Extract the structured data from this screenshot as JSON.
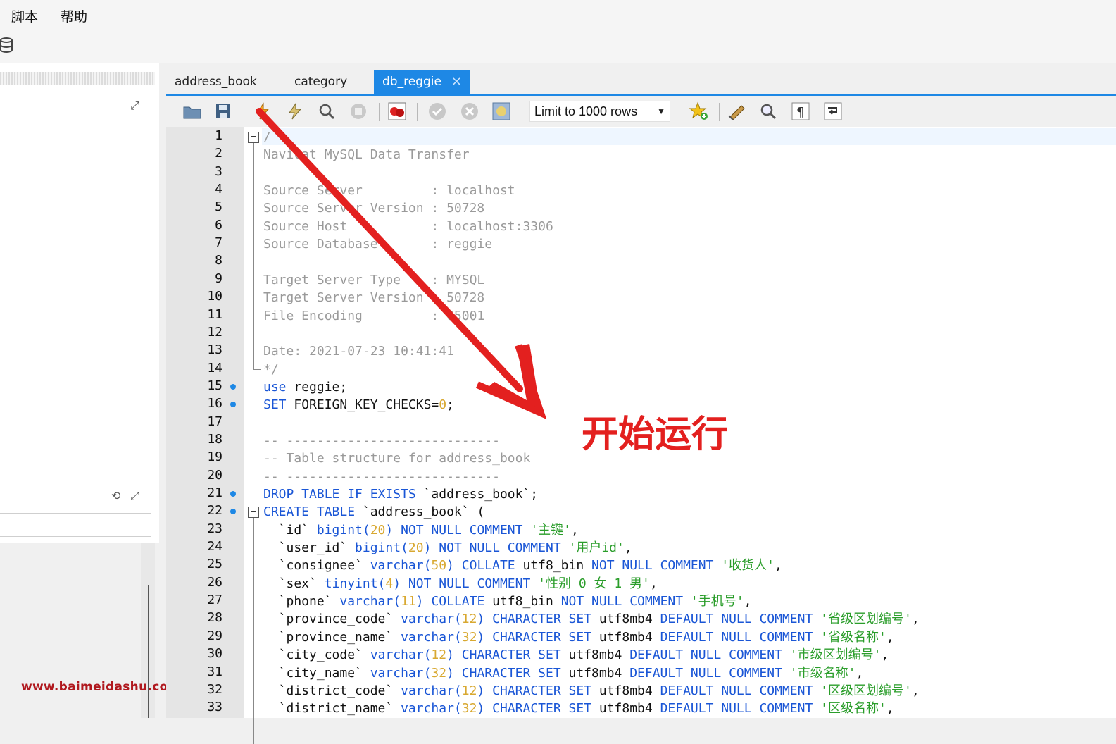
{
  "menu": {
    "items": [
      {
        "label": "脚本"
      },
      {
        "label": "帮助"
      }
    ]
  },
  "tabs": [
    {
      "label": "address_book"
    },
    {
      "label": "category"
    },
    {
      "label": "db_reggie",
      "close": "×"
    }
  ],
  "toolbar": {
    "limit_select": "Limit to 1000 rows"
  },
  "annotation": "开始运行",
  "watermark": "www.baimeidashu.com-白眉大叔",
  "colors": {
    "accent": "#1e88e5",
    "annotation": "#e3201f",
    "keyword": "#1a56d6",
    "string": "#2a9d2a",
    "number": "#d8a830",
    "comment": "#9a9a9a"
  },
  "icons": [
    "folder-icon",
    "save-icon",
    "run-icon",
    "run-selected-icon",
    "explain-icon",
    "stop-icon",
    "beautify-icon",
    "commit-icon",
    "rollback-icon",
    "transaction-icon",
    "add-favorite-icon",
    "clear-icon",
    "find-icon",
    "paragraph-icon",
    "wrap-icon",
    "arrow-annotation-icon"
  ],
  "editor": {
    "lines": [
      {
        "n": "1",
        "segs": [
          {
            "c": "cm",
            "t": "/"
          }
        ]
      },
      {
        "n": "2",
        "segs": [
          {
            "c": "cm",
            "t": "Navicat MySQL Data Transfer"
          }
        ]
      },
      {
        "n": "3",
        "segs": []
      },
      {
        "n": "4",
        "segs": [
          {
            "c": "cm",
            "t": "Source Server         : localhost"
          }
        ]
      },
      {
        "n": "5",
        "segs": [
          {
            "c": "cm",
            "t": "Source Server Version : 50728"
          }
        ]
      },
      {
        "n": "6",
        "segs": [
          {
            "c": "cm",
            "t": "Source Host           : localhost:3306"
          }
        ]
      },
      {
        "n": "7",
        "segs": [
          {
            "c": "cm",
            "t": "Source Database       : reggie"
          }
        ]
      },
      {
        "n": "8",
        "segs": []
      },
      {
        "n": "9",
        "segs": [
          {
            "c": "cm",
            "t": "Target Server Type    : MYSQL"
          }
        ]
      },
      {
        "n": "10",
        "segs": [
          {
            "c": "cm",
            "t": "Target Server Version : 50728"
          }
        ]
      },
      {
        "n": "11",
        "segs": [
          {
            "c": "cm",
            "t": "File Encoding         : 65001"
          }
        ]
      },
      {
        "n": "12",
        "segs": []
      },
      {
        "n": "13",
        "segs": [
          {
            "c": "cm",
            "t": "Date: 2021-07-23 10:41:41"
          }
        ]
      },
      {
        "n": "14",
        "segs": [
          {
            "c": "cm",
            "t": "*/"
          }
        ]
      },
      {
        "n": "15",
        "bm": true,
        "segs": [
          {
            "c": "kw",
            "t": "use"
          },
          {
            "c": "id",
            "t": " reggie;"
          }
        ]
      },
      {
        "n": "16",
        "bm": true,
        "segs": [
          {
            "c": "kw",
            "t": "SET"
          },
          {
            "c": "id",
            "t": " FOREIGN_KEY_CHECKS="
          },
          {
            "c": "num",
            "t": "0"
          },
          {
            "c": "id",
            "t": ";"
          }
        ]
      },
      {
        "n": "17",
        "segs": []
      },
      {
        "n": "18",
        "segs": [
          {
            "c": "cm",
            "t": "-- ----------------------------"
          }
        ]
      },
      {
        "n": "19",
        "segs": [
          {
            "c": "cm",
            "t": "-- Table structure for address_book"
          }
        ]
      },
      {
        "n": "20",
        "segs": [
          {
            "c": "cm",
            "t": "-- ----------------------------"
          }
        ]
      },
      {
        "n": "21",
        "bm": true,
        "segs": [
          {
            "c": "kw",
            "t": "DROP TABLE IF EXISTS"
          },
          {
            "c": "id",
            "t": " `address_book`;"
          }
        ]
      },
      {
        "n": "22",
        "bm": true,
        "segs": [
          {
            "c": "kw",
            "t": "CREATE TABLE"
          },
          {
            "c": "id",
            "t": " `address_book` ("
          }
        ]
      },
      {
        "n": "23",
        "segs": [
          {
            "c": "id",
            "t": "  `id` "
          },
          {
            "c": "kw",
            "t": "bigint("
          },
          {
            "c": "num",
            "t": "20"
          },
          {
            "c": "kw",
            "t": ") NOT NULL COMMENT "
          },
          {
            "c": "str",
            "t": "'主键'"
          },
          {
            "c": "id",
            "t": ","
          }
        ]
      },
      {
        "n": "24",
        "segs": [
          {
            "c": "id",
            "t": "  `user_id` "
          },
          {
            "c": "kw",
            "t": "bigint("
          },
          {
            "c": "num",
            "t": "20"
          },
          {
            "c": "kw",
            "t": ") NOT NULL COMMENT "
          },
          {
            "c": "str",
            "t": "'用户id'"
          },
          {
            "c": "id",
            "t": ","
          }
        ]
      },
      {
        "n": "25",
        "segs": [
          {
            "c": "id",
            "t": "  `consignee` "
          },
          {
            "c": "kw",
            "t": "varchar("
          },
          {
            "c": "num",
            "t": "50"
          },
          {
            "c": "kw",
            "t": ") COLLATE "
          },
          {
            "c": "id",
            "t": "utf8_bin "
          },
          {
            "c": "kw",
            "t": "NOT NULL COMMENT "
          },
          {
            "c": "str",
            "t": "'收货人'"
          },
          {
            "c": "id",
            "t": ","
          }
        ]
      },
      {
        "n": "26",
        "segs": [
          {
            "c": "id",
            "t": "  `sex` "
          },
          {
            "c": "kw",
            "t": "tinyint("
          },
          {
            "c": "num",
            "t": "4"
          },
          {
            "c": "kw",
            "t": ") NOT NULL COMMENT "
          },
          {
            "c": "str",
            "t": "'性别 0 女 1 男'"
          },
          {
            "c": "id",
            "t": ","
          }
        ]
      },
      {
        "n": "27",
        "segs": [
          {
            "c": "id",
            "t": "  `phone` "
          },
          {
            "c": "kw",
            "t": "varchar("
          },
          {
            "c": "num",
            "t": "11"
          },
          {
            "c": "kw",
            "t": ") COLLATE "
          },
          {
            "c": "id",
            "t": "utf8_bin "
          },
          {
            "c": "kw",
            "t": "NOT NULL COMMENT "
          },
          {
            "c": "str",
            "t": "'手机号'"
          },
          {
            "c": "id",
            "t": ","
          }
        ]
      },
      {
        "n": "28",
        "segs": [
          {
            "c": "id",
            "t": "  `province_code` "
          },
          {
            "c": "kw",
            "t": "varchar("
          },
          {
            "c": "num",
            "t": "12"
          },
          {
            "c": "kw",
            "t": ") CHARACTER SET "
          },
          {
            "c": "id",
            "t": "utf8mb4 "
          },
          {
            "c": "kw",
            "t": "DEFAULT NULL COMMENT "
          },
          {
            "c": "str",
            "t": "'省级区划编号'"
          },
          {
            "c": "id",
            "t": ","
          }
        ]
      },
      {
        "n": "29",
        "segs": [
          {
            "c": "id",
            "t": "  `province_name` "
          },
          {
            "c": "kw",
            "t": "varchar("
          },
          {
            "c": "num",
            "t": "32"
          },
          {
            "c": "kw",
            "t": ") CHARACTER SET "
          },
          {
            "c": "id",
            "t": "utf8mb4 "
          },
          {
            "c": "kw",
            "t": "DEFAULT NULL COMMENT "
          },
          {
            "c": "str",
            "t": "'省级名称'"
          },
          {
            "c": "id",
            "t": ","
          }
        ]
      },
      {
        "n": "30",
        "segs": [
          {
            "c": "id",
            "t": "  `city_code` "
          },
          {
            "c": "kw",
            "t": "varchar("
          },
          {
            "c": "num",
            "t": "12"
          },
          {
            "c": "kw",
            "t": ") CHARACTER SET "
          },
          {
            "c": "id",
            "t": "utf8mb4 "
          },
          {
            "c": "kw",
            "t": "DEFAULT NULL COMMENT "
          },
          {
            "c": "str",
            "t": "'市级区划编号'"
          },
          {
            "c": "id",
            "t": ","
          }
        ]
      },
      {
        "n": "31",
        "segs": [
          {
            "c": "id",
            "t": "  `city_name` "
          },
          {
            "c": "kw",
            "t": "varchar("
          },
          {
            "c": "num",
            "t": "32"
          },
          {
            "c": "kw",
            "t": ") CHARACTER SET "
          },
          {
            "c": "id",
            "t": "utf8mb4 "
          },
          {
            "c": "kw",
            "t": "DEFAULT NULL COMMENT "
          },
          {
            "c": "str",
            "t": "'市级名称'"
          },
          {
            "c": "id",
            "t": ","
          }
        ]
      },
      {
        "n": "32",
        "segs": [
          {
            "c": "id",
            "t": "  `district_code` "
          },
          {
            "c": "kw",
            "t": "varchar("
          },
          {
            "c": "num",
            "t": "12"
          },
          {
            "c": "kw",
            "t": ") CHARACTER SET "
          },
          {
            "c": "id",
            "t": "utf8mb4 "
          },
          {
            "c": "kw",
            "t": "DEFAULT NULL COMMENT "
          },
          {
            "c": "str",
            "t": "'区级区划编号'"
          },
          {
            "c": "id",
            "t": ","
          }
        ]
      },
      {
        "n": "33",
        "segs": [
          {
            "c": "id",
            "t": "  `district_name` "
          },
          {
            "c": "kw",
            "t": "varchar("
          },
          {
            "c": "num",
            "t": "32"
          },
          {
            "c": "kw",
            "t": ") CHARACTER SET "
          },
          {
            "c": "id",
            "t": "utf8mb4 "
          },
          {
            "c": "kw",
            "t": "DEFAULT NULL COMMENT "
          },
          {
            "c": "str",
            "t": "'区级名称'"
          },
          {
            "c": "id",
            "t": ","
          }
        ]
      }
    ]
  }
}
